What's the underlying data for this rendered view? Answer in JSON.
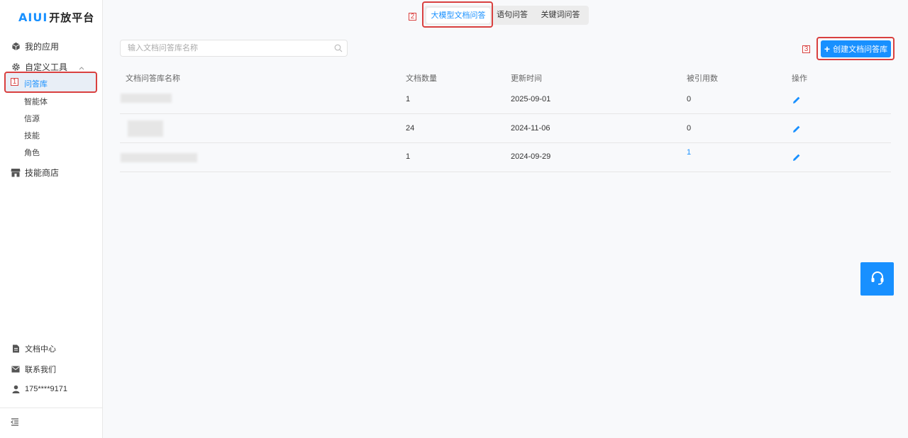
{
  "app": {
    "logo_mark": "AIUI",
    "logo_text": "开放平台"
  },
  "sidebar": {
    "my_apps": "我的应用",
    "custom_tools": "自定义工具",
    "sub_items": [
      "问答库",
      "智能体",
      "信源",
      "技能",
      "角色"
    ],
    "skill_store": "技能商店",
    "docs": "文档中心",
    "contact": "联系我们",
    "user": "175****9171"
  },
  "tabs": [
    "大模型文档问答",
    "语句问答",
    "关键词问答"
  ],
  "search": {
    "placeholder": "输入文档问答库名称"
  },
  "create_button": "创建文档问答库",
  "annotations": [
    "1",
    "2",
    "3"
  ],
  "table": {
    "headers": [
      "文档问答库名称",
      "文档数量",
      "更新时间",
      "被引用数",
      "操作"
    ],
    "rows": [
      {
        "count": "1",
        "updated": "2025-09-01",
        "refs": "0"
      },
      {
        "count": "24",
        "updated": "2024-11-06",
        "refs": "0"
      },
      {
        "count": "1",
        "updated": "2024-09-29",
        "refs": "1"
      }
    ]
  },
  "colors": {
    "accent": "#1890ff",
    "highlight": "#d9403f"
  }
}
